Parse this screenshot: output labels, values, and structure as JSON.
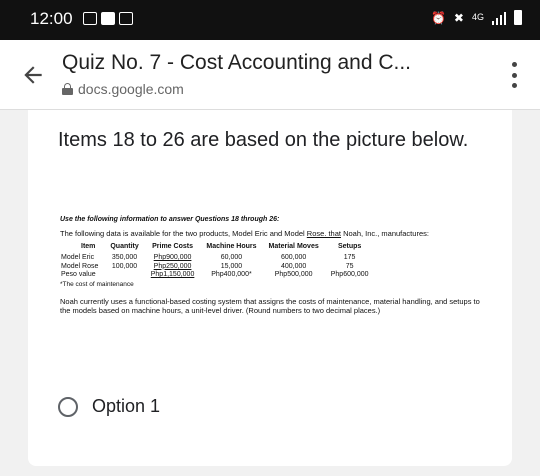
{
  "status_bar": {
    "time": "12:00",
    "network": "4G"
  },
  "app_bar": {
    "title": "Quiz No. 7 - Cost Accounting and C...",
    "url": "docs.google.com"
  },
  "question": {
    "title": "Items 18 to 26 are based on the picture below."
  },
  "doc_image": {
    "instruction": "Use the following information to answer Questions 18 through 26:",
    "intro_prefix": "The following data is available for the two products, Model Eric and Model ",
    "intro_link": "Rose. that",
    "intro_suffix": " Noah, Inc., manufactures:",
    "table": {
      "headers": [
        "Item",
        "Quantity",
        "Prime Costs",
        "Machine Hours",
        "Material Moves",
        "Setups"
      ],
      "rows": [
        {
          "item": "Model Eric",
          "quantity": "350,000",
          "prime_costs": "Php900,000",
          "machine_hours": "60,000",
          "material_moves": "600,000",
          "setups": "175"
        },
        {
          "item": "Model Rose",
          "quantity": "100,000",
          "prime_costs": "Php250,000",
          "machine_hours": "15,000",
          "material_moves": "400,000",
          "setups": "75"
        },
        {
          "item": "Peso value",
          "quantity": "",
          "prime_costs": "Php1,150,000",
          "machine_hours": "Php400,000*",
          "material_moves": "Php500,000",
          "setups": "Php600,000"
        }
      ]
    },
    "footnote": "*The cost of maintenance",
    "paragraph": "Noah currently uses a functional-based costing system that assigns the costs of maintenance, material handling, and setups to the models based on machine hours, a unit-level driver. (Round numbers to two decimal places.)"
  },
  "options": [
    {
      "label": "Option 1"
    }
  ]
}
